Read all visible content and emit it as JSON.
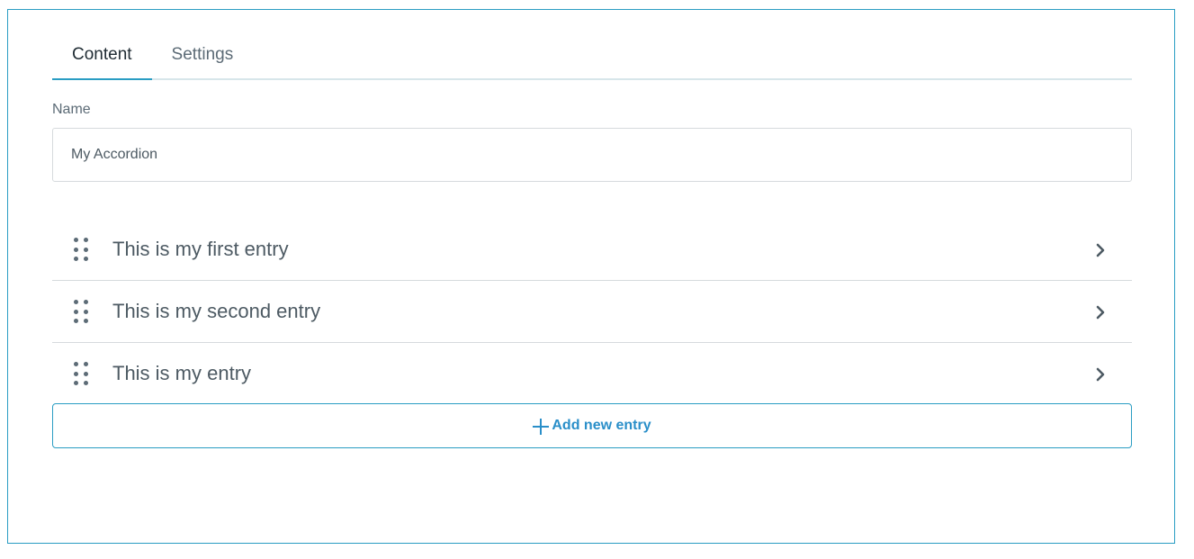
{
  "tabs": [
    {
      "label": "Content",
      "active": true
    },
    {
      "label": "Settings",
      "active": false
    }
  ],
  "name_field": {
    "label": "Name",
    "value": "My Accordion"
  },
  "entries": [
    {
      "title": "This is my first entry"
    },
    {
      "title": "This is my second entry"
    },
    {
      "title": "This is my entry"
    }
  ],
  "add_button": {
    "label": "Add new entry",
    "icon": "plus-icon"
  },
  "icons": {
    "drag_handle": "drag-handle-icon",
    "expand": "chevron-right-icon"
  },
  "colors": {
    "accent": "#2a9dc3",
    "text": "#4d5a63",
    "muted": "#5c6b76"
  }
}
